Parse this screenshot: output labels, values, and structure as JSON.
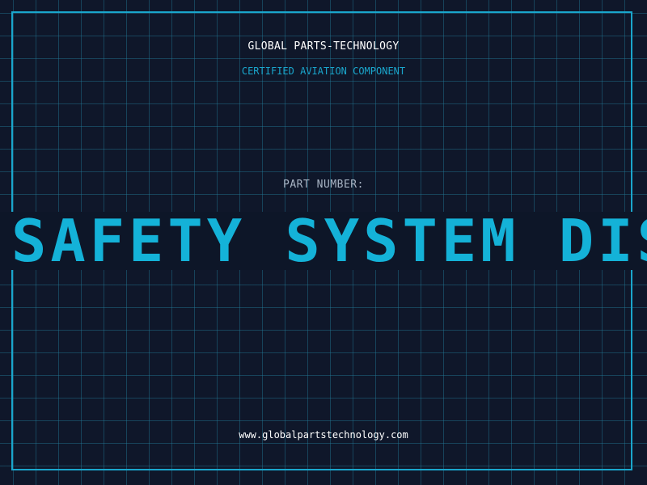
{
  "header": {
    "company": "GLOBAL PARTS-TECHNOLOGY",
    "subtitle": "CERTIFIED AVIATION COMPONENT"
  },
  "part": {
    "label": "PART NUMBER:",
    "value": "SAFETY SYSTEM DISA"
  },
  "footer": {
    "url": "www.globalpartstechnology.com"
  },
  "colors": {
    "background": "#0f172a",
    "accent": "#1aa6cc",
    "text": "#ffffff",
    "muted": "#a8b4c4"
  }
}
